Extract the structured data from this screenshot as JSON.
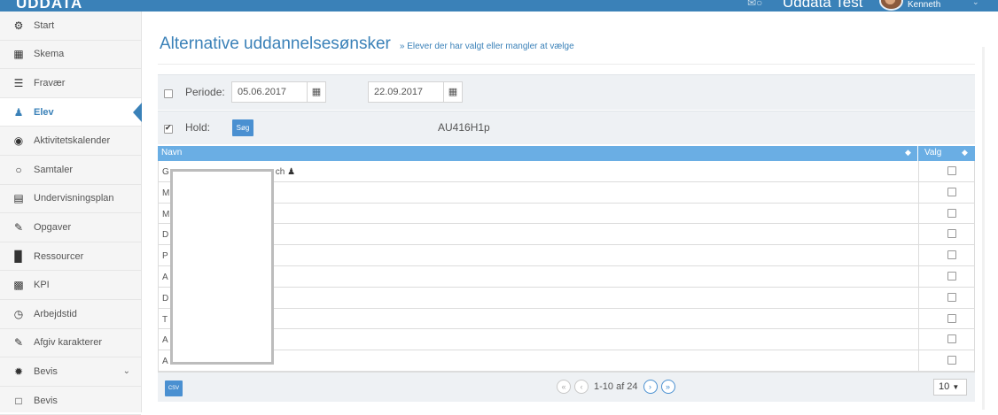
{
  "topbar": {
    "logo": "UDDATA",
    "school": "Uddata Test",
    "user": "Kenneth",
    "colors": {
      "bar": "#3a81b8"
    }
  },
  "sidebar": {
    "items": [
      {
        "label": "Start",
        "icon": "dashboard-icon"
      },
      {
        "label": "Skema",
        "icon": "calendar-icon"
      },
      {
        "label": "Fravær",
        "icon": "list-icon"
      },
      {
        "label": "Elev",
        "icon": "user-icon",
        "active": true
      },
      {
        "label": "Aktivitetskalender",
        "icon": "eye-icon"
      },
      {
        "label": "Samtaler",
        "icon": "chat-icon"
      },
      {
        "label": "Undervisningsplan",
        "icon": "table-icon"
      },
      {
        "label": "Opgaver",
        "icon": "pencil-icon"
      },
      {
        "label": "Ressourcer",
        "icon": "folder-icon"
      },
      {
        "label": "KPI",
        "icon": "bar-chart-icon"
      },
      {
        "label": "Arbejdstid",
        "icon": "clock-icon"
      },
      {
        "label": "Afgiv karakterer",
        "icon": "pencil-icon"
      },
      {
        "label": "Bevis",
        "icon": "certificate-icon",
        "expandable": true
      },
      {
        "label": "Bevis",
        "icon": "file-icon"
      }
    ]
  },
  "page": {
    "title": "Alternative uddannelsesønsker",
    "subtitle": "» Elever der har valgt eller mangler at vælge"
  },
  "filters": {
    "periode_label": "Periode:",
    "periode_checked": false,
    "date_from": "05.06.2017",
    "date_to": "22.09.2017",
    "hold_label": "Hold:",
    "hold_checked": true,
    "search_button": "Søg",
    "hold_code": "AU416H1p"
  },
  "table": {
    "col_name": "Navn",
    "col_valg": "Valg",
    "rows": [
      {
        "name": "G",
        "suffix": "ch"
      },
      {
        "name": "M",
        "suffix": ""
      },
      {
        "name": "M",
        "suffix": ""
      },
      {
        "name": "D",
        "suffix": ""
      },
      {
        "name": "P",
        "suffix": ""
      },
      {
        "name": "A",
        "suffix": ""
      },
      {
        "name": "D",
        "suffix": ""
      },
      {
        "name": "T",
        "suffix": ""
      },
      {
        "name": "A",
        "suffix": ""
      },
      {
        "name": "A",
        "suffix": ""
      }
    ],
    "csv_button": "CSV",
    "pager_text": "1-10 af 24",
    "per_page": "10"
  }
}
